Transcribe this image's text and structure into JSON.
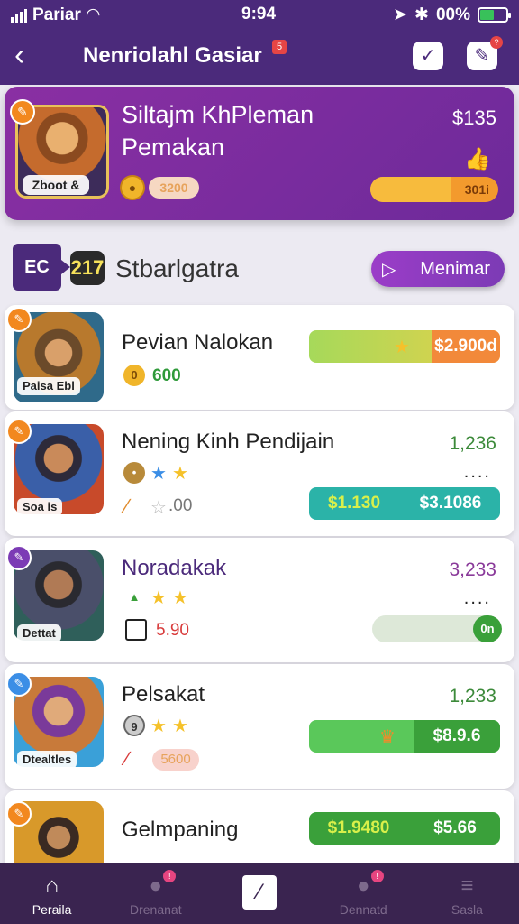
{
  "status": {
    "carrier": "Pariar",
    "time": "9:94",
    "battery": "00%"
  },
  "header": {
    "title": "Nenriolahl Gasiar",
    "badge": "5"
  },
  "hero": {
    "name1": "Siltajm KhPleman",
    "name2": "Pemakan",
    "price": "$135",
    "caption": "Zboot &",
    "chip": "3200",
    "bar_label": "301i",
    "progress": 0.63
  },
  "section": {
    "tag": "EC",
    "num": "217",
    "title": "Stbarlgatra",
    "button": "Menimar"
  },
  "items": [
    {
      "name": "Pevian Nalokan",
      "caption": "Paisa Ebl",
      "coin_value": "600",
      "pill_right": "$2.900d",
      "pill_color": "#f2893a"
    },
    {
      "name": "Nening Kinh Pendijain",
      "caption": "Soa is",
      "value": "1,236",
      "dots": "....",
      "rating_text": ".00",
      "pill_left": "$1.130",
      "pill_right": "$3.1086"
    },
    {
      "name": "Noradakak",
      "caption": "Dettat",
      "value": "3,233",
      "dots": "....",
      "tag_text": "5.90",
      "bar_label": "0n"
    },
    {
      "name": "Pelsakat",
      "caption": "Dtealtles",
      "value": "1,233",
      "chip": "5600",
      "pill_right": "$8.9.6"
    },
    {
      "name": "Gelmpaning",
      "pill_left": "$1.9480",
      "pill_right": "$5.66"
    }
  ],
  "nav": [
    {
      "label": "Peraila",
      "icon": "home-icon"
    },
    {
      "label": "Drenanat",
      "icon": "profile-icon"
    },
    {
      "label": "",
      "icon": "edit-icon"
    },
    {
      "label": "Dennatd",
      "icon": "user-icon"
    },
    {
      "label": "Sasla",
      "icon": "menu-icon"
    }
  ]
}
